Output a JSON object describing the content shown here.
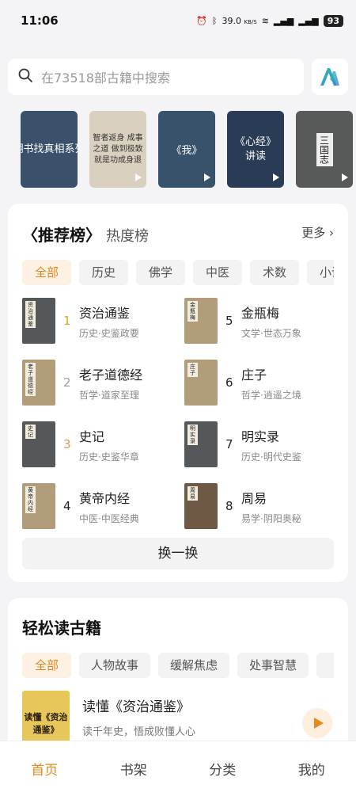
{
  "status": {
    "time": "11:06",
    "speed": "39.0",
    "speed_unit": "KB/S",
    "battery": "93"
  },
  "search": {
    "placeholder": "在73518部古籍中搜索"
  },
  "banners": [
    {
      "text": "翻书找真相系列",
      "icon": "none"
    },
    {
      "text": "智者返身 成事之道 做到极致 就是功成身退",
      "icon": "play-icon"
    },
    {
      "text": "《我》",
      "icon": "play-icon"
    },
    {
      "text": "《心经》讲读",
      "icon": "play-icon"
    },
    {
      "text": "三国志",
      "icon": "play-icon"
    }
  ],
  "rank": {
    "tab_active": "〈推荐榜〉",
    "tab_other": "热度榜",
    "more": "更多",
    "chips": [
      "全部",
      "历史",
      "佛学",
      "中医",
      "术数",
      "小说"
    ],
    "items": [
      {
        "num": "1",
        "title": "资治通鉴",
        "sub": "历史·史鉴政要",
        "cover_label": "资治通鉴",
        "style": "dark"
      },
      {
        "num": "5",
        "title": "金瓶梅",
        "sub": "文学·世态万象",
        "cover_label": "金瓶梅",
        "style": "light"
      },
      {
        "num": "2",
        "title": "老子道德经",
        "sub": "哲学·道家至理",
        "cover_label": "老子道德经",
        "style": "light"
      },
      {
        "num": "6",
        "title": "庄子",
        "sub": "哲学·逍遥之境",
        "cover_label": "庄子",
        "style": "light"
      },
      {
        "num": "3",
        "title": "史记",
        "sub": "历史·史鉴华章",
        "cover_label": "史记",
        "style": "dark"
      },
      {
        "num": "7",
        "title": "明实录",
        "sub": "历史·明代史鉴",
        "cover_label": "明实录",
        "style": "dark"
      },
      {
        "num": "4",
        "title": "黄帝内经",
        "sub": "中医·中医经典",
        "cover_label": "黄帝内经",
        "style": "light"
      },
      {
        "num": "8",
        "title": "周易",
        "sub": "易学·阴阳奥秘",
        "cover_label": "周易",
        "style": "light"
      }
    ],
    "refresh": "换一换"
  },
  "easy": {
    "title": "轻松读古籍",
    "chips": [
      "全部",
      "人物故事",
      "缓解焦虑",
      "处事智慧",
      "人"
    ],
    "item": {
      "cover_text": "读懂《资治通鉴》",
      "name": "读懂《资治通鉴》",
      "desc": "读千年史，悟成败懂人心"
    }
  },
  "nav": [
    "首页",
    "书架",
    "分类",
    "我的"
  ],
  "colors": {
    "accent": "#e5891a",
    "chip_active_bg": "#fdf1e3"
  }
}
